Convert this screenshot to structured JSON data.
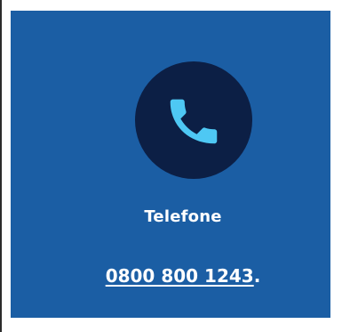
{
  "contact_card": {
    "title": "Telefone",
    "phone": "0800 800 1243",
    "trailing": "."
  },
  "icons": {
    "main": "phone-icon"
  },
  "colors": {
    "card_background": "#1b5ea4",
    "icon_circle": "#0c1f45",
    "icon_accent": "#4ec8f4",
    "text": "#ffffff"
  }
}
